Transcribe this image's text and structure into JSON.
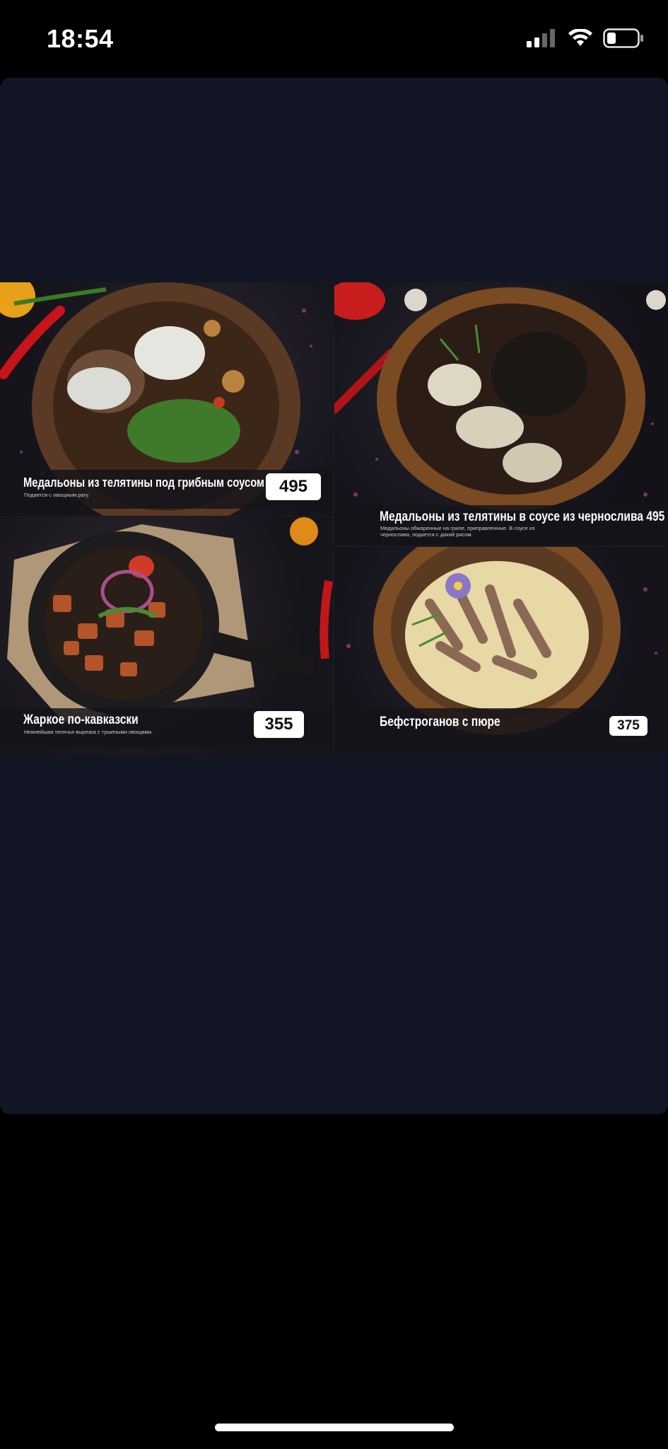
{
  "status_bar": {
    "time": "18:54"
  },
  "menu": {
    "items": [
      {
        "name": "Медальоны из телятины  под грибным соусом",
        "description": "Подается с овощным рагу.",
        "price": "495"
      },
      {
        "name": "Медальоны из телятины в соусе из чернослива 495",
        "description": "Медальоны обжаренные на гриле, приправленные. В соусе из чернослива, подается с дикий рисом.",
        "price": ""
      },
      {
        "name": "Жаркое по-кавказски",
        "description": "Нежнейшая телячья вырезка с тушеными овощами.",
        "price": "355"
      },
      {
        "name": "Бефстроганов с пюре",
        "description": "",
        "price": "375"
      }
    ]
  },
  "colors": {
    "viewer_bg": "#121524",
    "caption_bg": "#14141a",
    "price_bg": "#ffffff"
  }
}
